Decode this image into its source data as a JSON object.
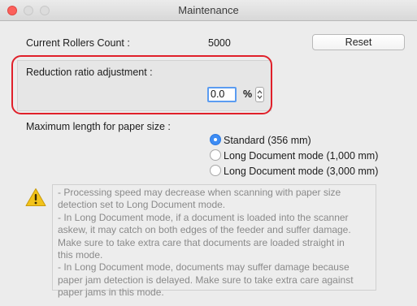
{
  "window": {
    "title": "Maintenance"
  },
  "rollers": {
    "label": "Current Rollers Count :",
    "value": "5000",
    "reset_label": "Reset"
  },
  "reduction": {
    "label": "Reduction ratio adjustment :",
    "value": "0.0",
    "unit": "%"
  },
  "paper": {
    "label": "Maximum length for paper size :",
    "options": [
      {
        "label": "Standard (356 mm)",
        "selected": true
      },
      {
        "label": "Long Document mode (1,000 mm)",
        "selected": false
      },
      {
        "label": "Long Document mode (3,000 mm)",
        "selected": false
      }
    ]
  },
  "note": {
    "lines": [
      "- Processing speed may decrease when scanning with paper size",
      "detection set to Long Document mode.",
      "- In Long Document mode, if a document is loaded into the scanner",
      "askew, it may catch on both edges of the feeder and suffer damage.",
      "Make sure to take extra care that documents are loaded straight in",
      "this mode.",
      "- In Long Document mode, documents may suffer damage because",
      "paper jam detection is delayed. Make sure to take extra care against",
      "paper jams in this mode."
    ]
  },
  "colors": {
    "accent": "#3d8cf4",
    "highlight": "#e0202a",
    "warning": "#f2c31a"
  },
  "icons": {
    "warning": "warning-icon",
    "stepper": "stepper-arrows-icon"
  }
}
